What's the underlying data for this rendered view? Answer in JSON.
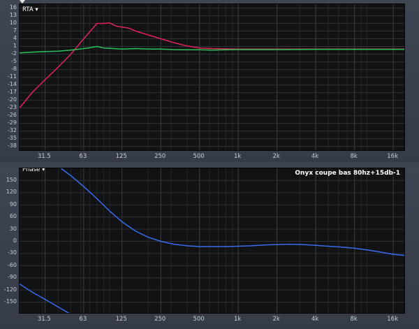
{
  "rta": {
    "menu_label": "RTA ▾",
    "y_ticks": [
      16,
      13,
      10,
      7,
      4,
      1,
      -2,
      -5,
      -8,
      -11,
      -14,
      -17,
      -20,
      -23,
      -26,
      -29,
      -32,
      -35,
      -38
    ],
    "y_labels": [
      "16",
      "13",
      "10",
      "7",
      "4",
      "1",
      "-2",
      "-5",
      "-8",
      "-11",
      "-14",
      "-17",
      "-20",
      "-23",
      "-26",
      "-29",
      "-32",
      "-35",
      "-38"
    ],
    "ylim": [
      -40,
      17.5
    ],
    "x_ticks": [
      31.5,
      63,
      125,
      250,
      500,
      1000,
      2000,
      4000,
      8000,
      16000
    ],
    "x_labels": [
      "31.5",
      "63",
      "125",
      "250",
      "500",
      "1k",
      "2k",
      "4k",
      "8k",
      "16k"
    ],
    "xlim": [
      20,
      20000
    ],
    "series": [
      {
        "color": "#e0245a",
        "points": [
          [
            20,
            -23
          ],
          [
            25,
            -17
          ],
          [
            31.5,
            -12
          ],
          [
            40,
            -7
          ],
          [
            50,
            -2
          ],
          [
            63,
            4
          ],
          [
            80,
            10
          ],
          [
            90,
            10
          ],
          [
            100,
            10.2
          ],
          [
            112,
            9
          ],
          [
            125,
            8.6
          ],
          [
            140,
            8.2
          ],
          [
            160,
            7
          ],
          [
            200,
            5.5
          ],
          [
            250,
            4
          ],
          [
            315,
            2.5
          ],
          [
            400,
            1.2
          ],
          [
            500,
            0.4
          ],
          [
            630,
            0.2
          ],
          [
            800,
            0.1
          ],
          [
            1000,
            0
          ],
          [
            2000,
            0
          ],
          [
            4000,
            0
          ],
          [
            8000,
            0
          ],
          [
            16000,
            0
          ],
          [
            20000,
            0
          ]
        ]
      },
      {
        "color": "#2ec15a",
        "points": [
          [
            20,
            -1.5
          ],
          [
            25,
            -1.2
          ],
          [
            31.5,
            -1
          ],
          [
            40,
            -0.8
          ],
          [
            50,
            -0.4
          ],
          [
            63,
            0.2
          ],
          [
            70,
            0.5
          ],
          [
            80,
            1
          ],
          [
            90,
            0.4
          ],
          [
            100,
            0.3
          ],
          [
            125,
            0
          ],
          [
            160,
            0.2
          ],
          [
            200,
            0
          ],
          [
            250,
            0
          ],
          [
            315,
            -0.2
          ],
          [
            400,
            -0.3
          ],
          [
            500,
            -0.3
          ],
          [
            630,
            -0.4
          ],
          [
            800,
            -0.3
          ],
          [
            1000,
            -0.2
          ],
          [
            2000,
            -0.2
          ],
          [
            4000,
            -0.1
          ],
          [
            8000,
            -0.1
          ],
          [
            16000,
            -0.1
          ],
          [
            20000,
            -0.1
          ]
        ]
      }
    ]
  },
  "phase": {
    "menu_label": "Phase ▾",
    "trace_label": "Onyx coupe bas 80hz+15db-1",
    "y_ticks": [
      150,
      120,
      90,
      60,
      30,
      0,
      -30,
      -60,
      -90,
      -120,
      -150
    ],
    "y_labels": [
      "150",
      "120",
      "90",
      "60",
      "30",
      "0",
      "-30",
      "-60",
      "-90",
      "-120",
      "-150"
    ],
    "ylim": [
      -180,
      180
    ],
    "x_ticks": [
      31.5,
      63,
      125,
      250,
      500,
      1000,
      2000,
      4000,
      8000,
      16000
    ],
    "x_labels": [
      "31.5",
      "63",
      "125",
      "250",
      "500",
      "1k",
      "2k",
      "4k",
      "8k",
      "16k"
    ],
    "xlim": [
      20,
      20000
    ],
    "series": [
      {
        "color": "#3a6cf0",
        "points": [
          [
            42,
            180
          ],
          [
            50,
            162
          ],
          [
            63,
            135
          ],
          [
            80,
            105
          ],
          [
            100,
            75
          ],
          [
            125,
            48
          ],
          [
            160,
            25
          ],
          [
            200,
            10
          ],
          [
            250,
            0
          ],
          [
            315,
            -7
          ],
          [
            400,
            -11
          ],
          [
            500,
            -13
          ],
          [
            630,
            -13
          ],
          [
            800,
            -13
          ],
          [
            1000,
            -12
          ],
          [
            1250,
            -11
          ],
          [
            1600,
            -9
          ],
          [
            2000,
            -8
          ],
          [
            2500,
            -7
          ],
          [
            3150,
            -8
          ],
          [
            4000,
            -10
          ],
          [
            5000,
            -12
          ],
          [
            6300,
            -14
          ],
          [
            8000,
            -17
          ],
          [
            10000,
            -21
          ],
          [
            12500,
            -26
          ],
          [
            16000,
            -32
          ],
          [
            20000,
            -35
          ]
        ]
      },
      {
        "color": "#3a6cf0",
        "points": [
          [
            20,
            -105
          ],
          [
            25,
            -125
          ],
          [
            31.5,
            -143
          ],
          [
            40,
            -162
          ],
          [
            50,
            -180
          ]
        ]
      }
    ]
  }
}
